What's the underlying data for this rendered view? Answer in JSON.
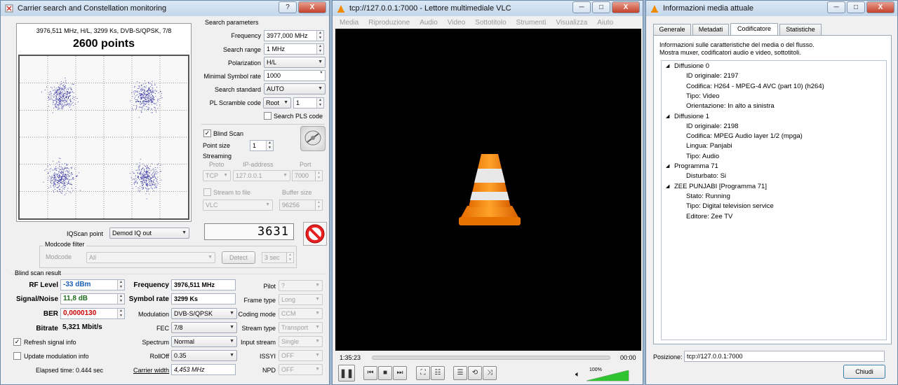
{
  "carrier": {
    "title": "Carrier search and Constellation monitoring",
    "title_buttons": [
      "?",
      "X"
    ],
    "info": "3976,511 MHz, H/L, 3299 Ks, DVB-S/QPSK, 7/8",
    "points": "2600 points",
    "search_params": {
      "heading": "Search parameters",
      "frequency_label": "Frequency",
      "frequency": "3977,000 MHz",
      "range_label": "Search range",
      "range": "1 MHz",
      "pol_label": "Polarization",
      "pol": "H/L",
      "msr_label": "Minimal Symbol rate",
      "msr": "1000",
      "std_label": "Search standard",
      "std": "AUTO",
      "pls_label": "PL Scramble code",
      "pls_mode": "Root",
      "pls_value": "1",
      "search_pls": "Search PLS code"
    },
    "blind_scan": "Blind Scan",
    "point_size_label": "Point size",
    "point_size": "1",
    "streaming": {
      "heading": "Streaming",
      "proto_h": "Proto",
      "ip_h": "IP-address",
      "port_h": "Port",
      "proto": "TCP",
      "ip": "127.0.0.1",
      "port": "7000",
      "to_file": "Stream to file",
      "buffer_h": "Buffer size",
      "player": "VLC",
      "buffer": "96256"
    },
    "counter": "3631",
    "iqscan_label": "IQScan point",
    "iqscan": "Demod IQ out",
    "modcode_filter": "Modcode filter",
    "modcode_label": "Modcode",
    "modcode": "All",
    "detect": "Detect",
    "interval": "3 sec",
    "result": {
      "heading": "Blind scan result",
      "rf_label": "RF Level",
      "rf": "-33 dBm",
      "sn_label": "Signal/Noise",
      "sn": "11,8 dB",
      "ber_label": "BER",
      "ber": "0,0000130",
      "bitrate_label": "Bitrate",
      "bitrate": "5,321 Mbit/s",
      "freq_label": "Frequency",
      "freq": "3976,511 MHz",
      "sr_label": "Symbol rate",
      "sr": "3299 Ks",
      "mod_label": "Modulation",
      "mod": "DVB-S/QPSK",
      "fec_label": "FEC",
      "fec": "7/8",
      "spectrum_label": "Spectrum",
      "spectrum": "Normal",
      "rolloff_label": "RollOff",
      "rolloff": "0.35",
      "cw_label": "Carrier width",
      "cw": "4,453 MHz",
      "pilot_label": "Pilot",
      "pilot": "?",
      "frame_label": "Frame type",
      "frame": "Long",
      "coding_label": "Coding mode",
      "coding": "CCM",
      "stream_label": "Stream type",
      "stream": "Transport",
      "input_label": "Input stream",
      "input": "Single",
      "issyi_label": "ISSYI",
      "issyi": "OFF",
      "npd_label": "NPD",
      "npd": "OFF"
    },
    "refresh": "Refresh signal info",
    "update_mod": "Update modulation info",
    "elapsed": "Elapsed time: 0.444 sec"
  },
  "vlc": {
    "title": "tcp://127.0.0.1:7000 - Lettore multimediale VLC",
    "menu": [
      "Media",
      "Riproduzione",
      "Audio",
      "Video",
      "Sottotitolo",
      "Strumenti",
      "Visualizza",
      "Aiuto"
    ],
    "time_elapsed": "1:35:23",
    "time_total": "00:00",
    "volume": "100%",
    "progress": 0.0,
    "volume_level": 1.0
  },
  "info": {
    "title": "Informazioni media attuale",
    "tabs": [
      "Generale",
      "Metadati",
      "Codificatore",
      "Statistiche"
    ],
    "desc1": "Informazioni sulle caratteristiche del media o del flusso.",
    "desc2": "Mostra muxer, codificatori audio e video, sottotitoli.",
    "tree": [
      {
        "t": "Diffusione 0",
        "c": [
          "ID originale: 2197",
          "Codifica: H264 - MPEG-4 AVC (part 10) (h264)",
          "Tipo: Video",
          "Orientazione: In alto a sinistra"
        ]
      },
      {
        "t": "Diffusione 1",
        "c": [
          "ID originale: 2198",
          "Codifica: MPEG Audio layer 1/2 (mpga)",
          "Lingua: Panjabi",
          "Tipo: Audio"
        ]
      },
      {
        "t": "Programma 71",
        "c": [
          "Disturbato: Si"
        ]
      },
      {
        "t": "ZEE PUNJABI [Programma 71]",
        "c": [
          "Stato: Running",
          "Tipo: Digital television service",
          "Editore: Zee TV"
        ]
      }
    ],
    "pos_label": "Posizione:",
    "pos": "tcp://127.0.0.1:7000",
    "close": "Chiudi"
  },
  "colors": {
    "rf": "#1a5fb4",
    "sn": "#1e6e1e",
    "ber": "#cc0000",
    "dots": "#2a2aa0"
  }
}
